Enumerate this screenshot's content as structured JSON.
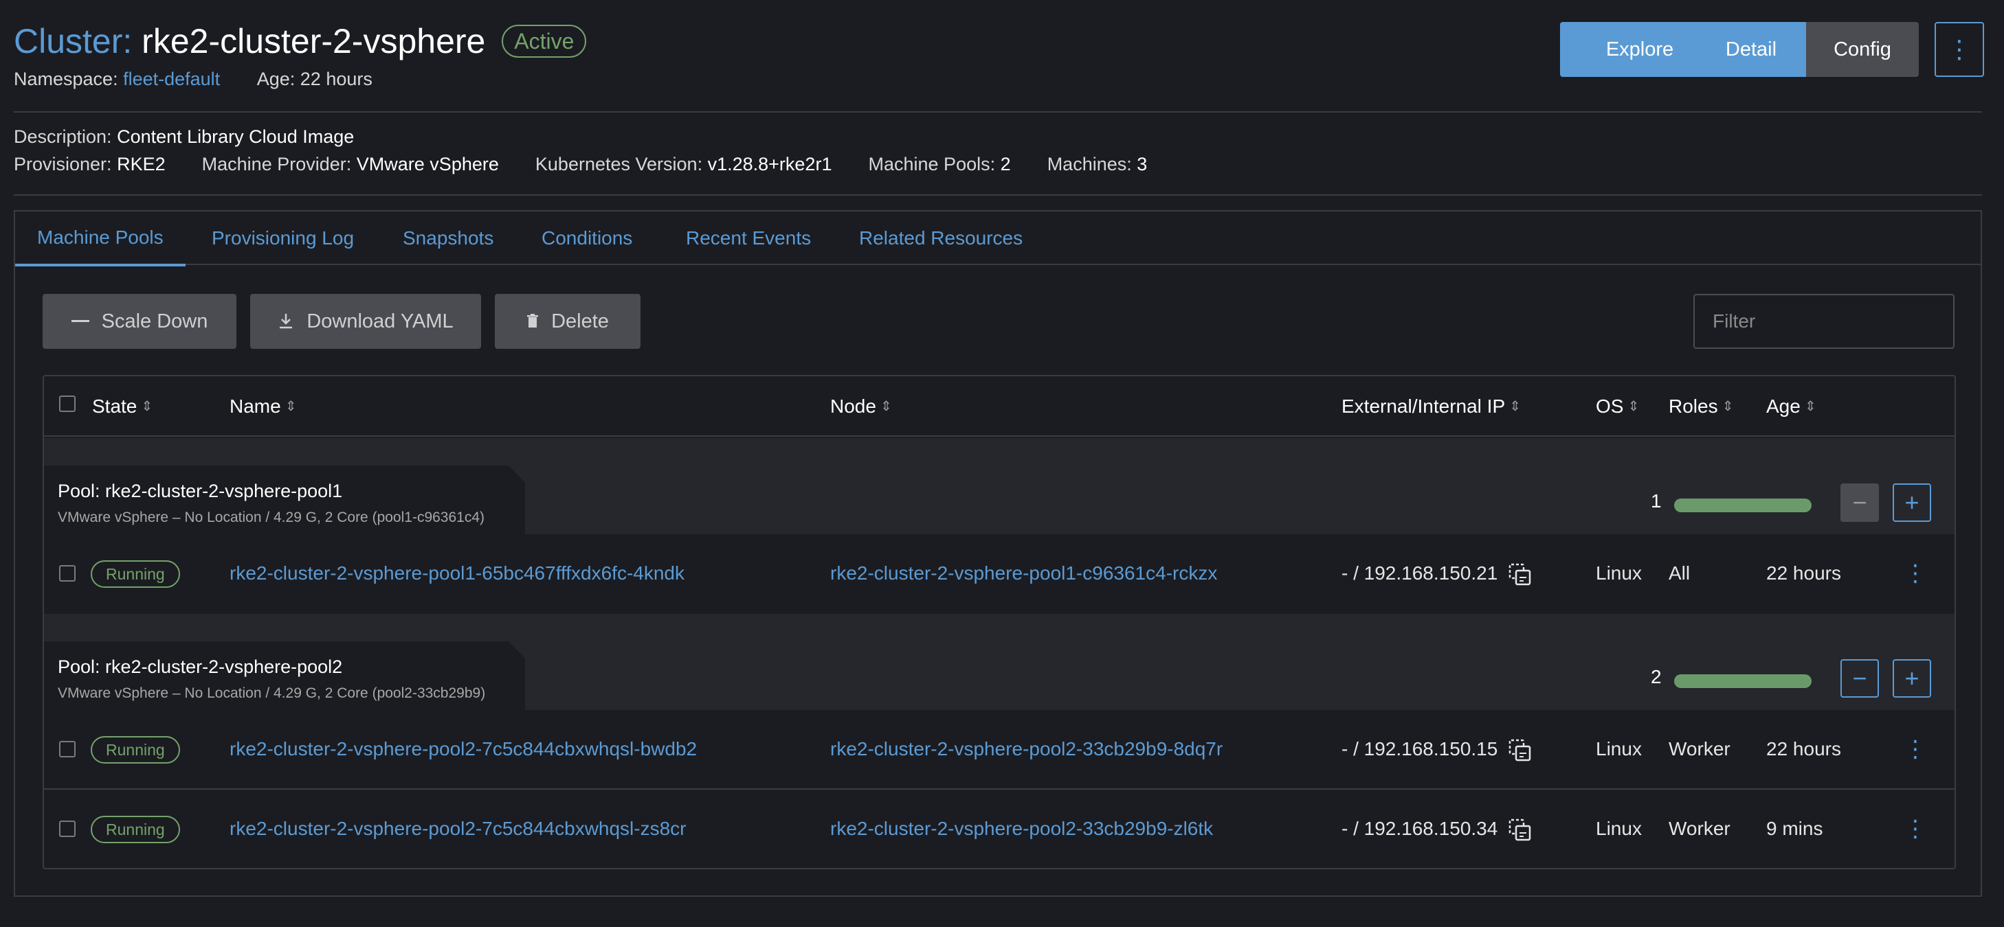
{
  "header": {
    "cluster_label": "Cluster:",
    "cluster_name": "rke2-cluster-2-vsphere",
    "status": "Active",
    "namespace_label": "Namespace:",
    "namespace": "fleet-default",
    "age_label": "Age:",
    "age": "22 hours",
    "buttons": {
      "explore": "Explore",
      "detail": "Detail",
      "config": "Config",
      "more": "⋮"
    }
  },
  "meta": {
    "description_label": "Description:",
    "description": "Content Library Cloud Image",
    "provisioner_label": "Provisioner:",
    "provisioner": "RKE2",
    "machine_provider_label": "Machine Provider:",
    "machine_provider": "VMware vSphere",
    "k8s_version_label": "Kubernetes Version:",
    "k8s_version": "v1.28.8+rke2r1",
    "machine_pools_label": "Machine Pools:",
    "machine_pools": "2",
    "machines_label": "Machines:",
    "machines": "3"
  },
  "tabs": [
    "Machine Pools",
    "Provisioning Log",
    "Snapshots",
    "Conditions",
    "Recent Events",
    "Related Resources"
  ],
  "actions": {
    "scale_down": "Scale Down",
    "download_yaml": "Download YAML",
    "delete": "Delete",
    "filter_placeholder": "Filter"
  },
  "table": {
    "columns": [
      "State",
      "Name",
      "Node",
      "External/Internal IP",
      "OS",
      "Roles",
      "Age"
    ],
    "pools": [
      {
        "title": "Pool: rke2-cluster-2-vsphere-pool1",
        "subtitle": "VMware vSphere – No Location / 4.29 G, 2 Core (pool1-c96361c4)",
        "count": "1",
        "rows": [
          {
            "state": "Running",
            "name": "rke2-cluster-2-vsphere-pool1-65bc467fffxdx6fc-4kndk",
            "node": "rke2-cluster-2-vsphere-pool1-c96361c4-rckzx",
            "ip": "- / 192.168.150.21",
            "os": "Linux",
            "roles": "All",
            "age": "22 hours"
          }
        ]
      },
      {
        "title": "Pool: rke2-cluster-2-vsphere-pool2",
        "subtitle": "VMware vSphere – No Location / 4.29 G, 2 Core (pool2-33cb29b9)",
        "count": "2",
        "rows": [
          {
            "state": "Running",
            "name": "rke2-cluster-2-vsphere-pool2-7c5c844cbxwhqsl-bwdb2",
            "node": "rke2-cluster-2-vsphere-pool2-33cb29b9-8dq7r",
            "ip": "- / 192.168.150.15",
            "os": "Linux",
            "roles": "Worker",
            "age": "22 hours"
          },
          {
            "state": "Running",
            "name": "rke2-cluster-2-vsphere-pool2-7c5c844cbxwhqsl-zs8cr",
            "node": "rke2-cluster-2-vsphere-pool2-33cb29b9-zl6tk",
            "ip": "- / 192.168.150.34",
            "os": "Linux",
            "roles": "Worker",
            "age": "9 mins"
          }
        ]
      }
    ]
  },
  "colors": {
    "accent": "#5b9bd5",
    "active_green": "#74a26b",
    "progress_green": "#6b9a6a",
    "background": "#1b1c21"
  }
}
